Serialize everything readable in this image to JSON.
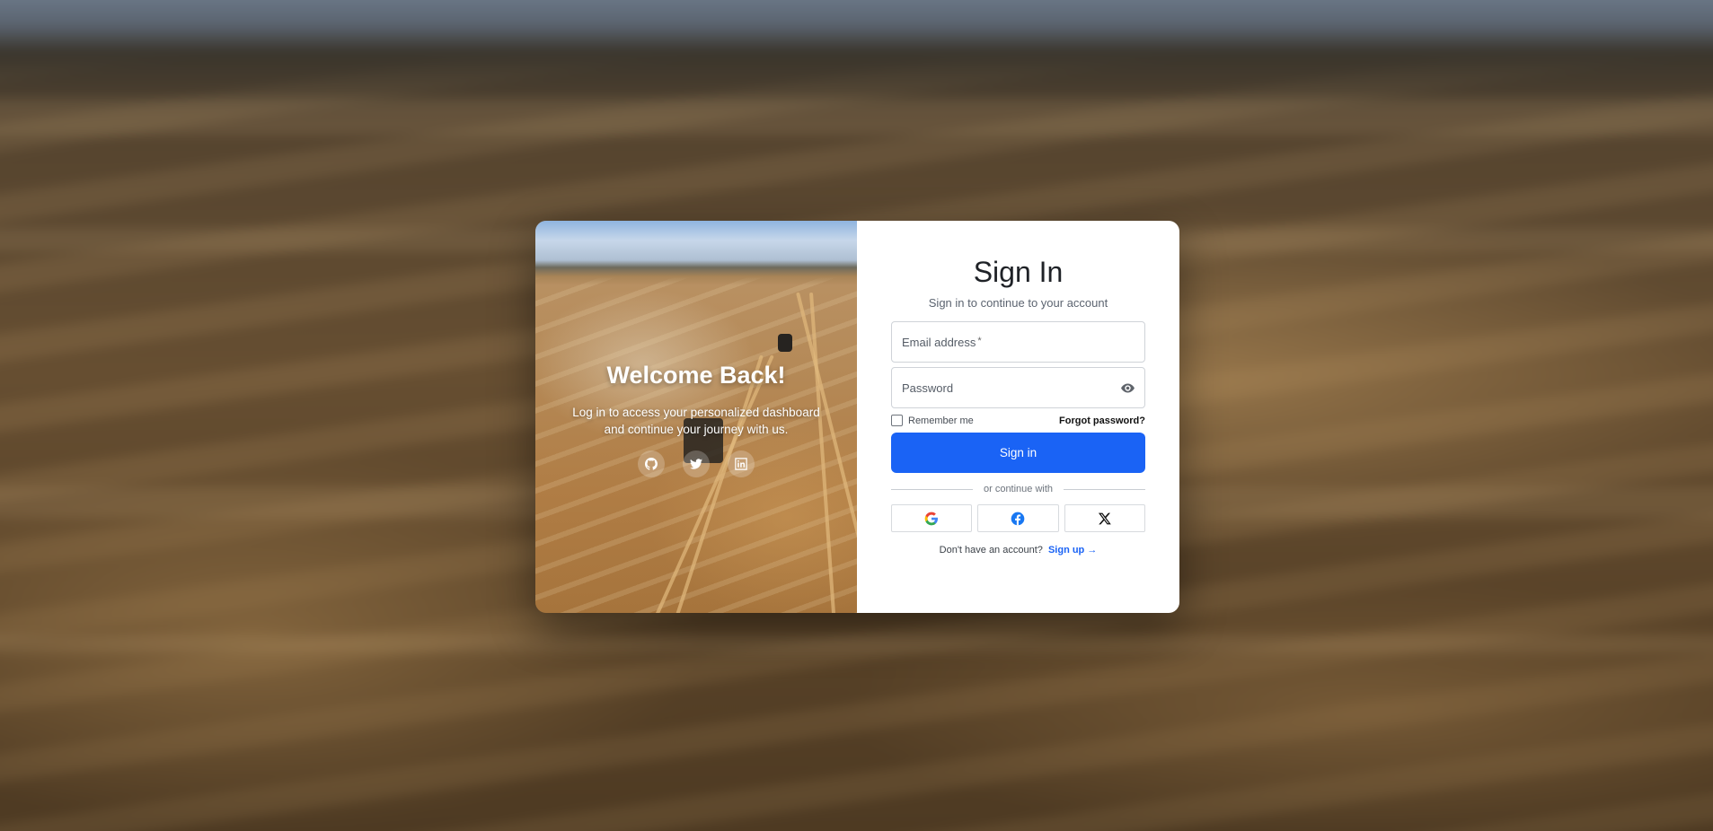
{
  "hero": {
    "title": "Welcome Back!",
    "text": "Log in to access your personalized dashboard and continue your journey with us.",
    "social": [
      {
        "icon": "github-icon"
      },
      {
        "icon": "twitter-icon"
      },
      {
        "icon": "linkedin-icon"
      }
    ]
  },
  "form": {
    "title": "Sign In",
    "subtitle": "Sign in to continue to your account",
    "email_label": "Email address",
    "email_required_mark": "*",
    "email_value": "",
    "password_label": "Password",
    "password_value": "",
    "remember_label": "Remember me",
    "remember_checked": false,
    "forgot_label": "Forgot password?",
    "submit_label": "Sign in",
    "divider_text": "or continue with",
    "providers": [
      {
        "icon": "google-icon"
      },
      {
        "icon": "facebook-icon"
      },
      {
        "icon": "x-icon"
      }
    ],
    "signup_prompt": "Don't have an account?",
    "signup_link": "Sign up →"
  },
  "colors": {
    "primary": "#1a63f5",
    "card_bg": "#ffffff",
    "title_text": "#1f2227"
  }
}
